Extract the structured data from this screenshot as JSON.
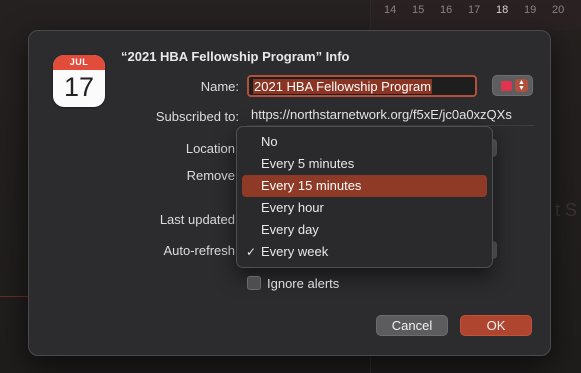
{
  "background": {
    "day_numbers": [
      "14",
      "15",
      "16",
      "17",
      "18",
      "19",
      "20"
    ],
    "ghost_text": "t S"
  },
  "dialog": {
    "icon": {
      "month": "JUL",
      "day": "17"
    },
    "title": "“2021 HBA Fellowship Program” Info",
    "name_label": "Name:",
    "name_value": "2021 HBA Fellowship Program",
    "color_value": "#e0344f",
    "subscribed_label": "Subscribed to:",
    "subscribed_url": "https://northstarnetwork.org/f5xE/jc0a0xzQXs",
    "location_label": "Location",
    "remove_label": "Remove",
    "last_updated_label": "Last updated",
    "auto_refresh_label": "Auto-refresh",
    "refresh_menu": {
      "options": [
        "No",
        "Every 5 minutes",
        "Every 15 minutes",
        "Every hour",
        "Every day",
        "Every week"
      ],
      "highlighted": "Every 15 minutes",
      "checked": "Every week"
    },
    "ignore_alerts_label": "Ignore alerts",
    "ignore_alerts_checked": false,
    "cancel_label": "Cancel",
    "ok_label": "OK"
  },
  "colors": {
    "accent": "#b0503d",
    "highlight": "#8f3a27",
    "ok_button": "#b0452f"
  }
}
